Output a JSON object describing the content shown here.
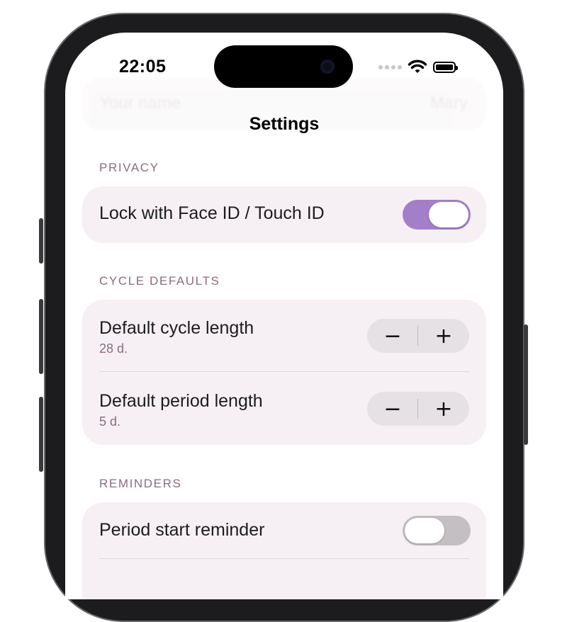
{
  "status_bar": {
    "time": "22:05"
  },
  "ghost_row": {
    "label": "Your name",
    "value": "Mary"
  },
  "nav": {
    "title": "Settings"
  },
  "privacy": {
    "header": "PRIVACY",
    "lock_label": "Lock with Face ID / Touch ID",
    "lock_enabled": true
  },
  "cycle_defaults": {
    "header": "CYCLE DEFAULTS",
    "rows": [
      {
        "label": "Default cycle length",
        "value": "28 d.",
        "minus": "−",
        "plus": "+"
      },
      {
        "label": "Default period length",
        "value": "5 d.",
        "minus": "−",
        "plus": "+"
      }
    ]
  },
  "reminders": {
    "header": "REMINDERS",
    "period_start_label": "Period start reminder",
    "period_start_enabled": false
  },
  "colors": {
    "accent": "#a37fca",
    "card_bg": "#f6f0f4",
    "section_header": "#8a6e80",
    "toggle_off": "#c3bfc3"
  },
  "icons": [
    "wifi-icon",
    "battery-icon",
    "cellular-signal-icon",
    "minus-icon",
    "plus-icon"
  ]
}
